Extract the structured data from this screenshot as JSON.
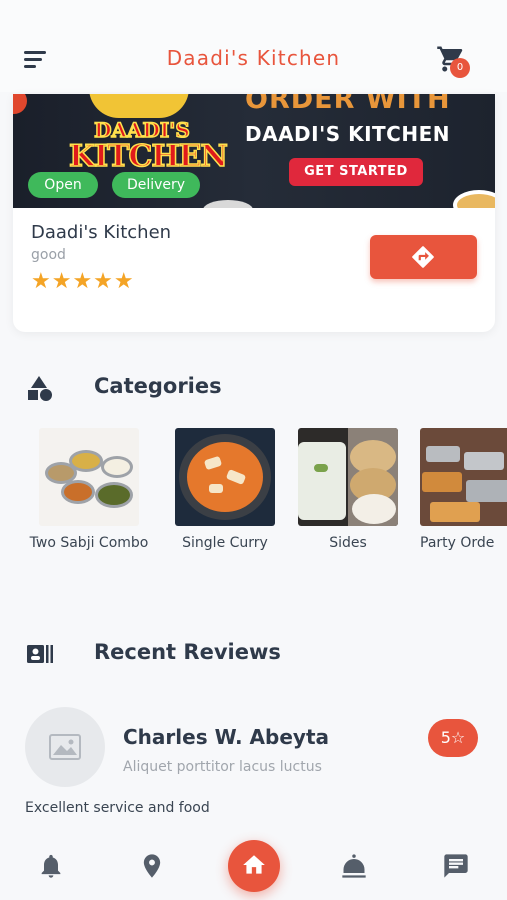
{
  "header": {
    "title": "Daadi's Kitchen",
    "cart_count": "0"
  },
  "restaurant": {
    "banner": {
      "logo_top": "DAADI'S",
      "logo_bottom": "KITCHEN",
      "promo_line1": "ORDER WITH",
      "promo_line2": "DAADI'S KITCHEN",
      "promo_cta": "GET STARTED"
    },
    "status_open": "Open",
    "status_delivery": "Delivery",
    "name": "Daadi's Kitchen",
    "tagline": "good",
    "rating": 5,
    "stars": "★★★★★"
  },
  "categories": {
    "title": "Categories",
    "items": [
      {
        "label": "Two Sabji Combo"
      },
      {
        "label": "Single Curry"
      },
      {
        "label": "Sides"
      },
      {
        "label": "Party Orde"
      }
    ]
  },
  "reviews": {
    "title": "Recent Reviews",
    "items": [
      {
        "name": "Charles W. Abeyta",
        "subtitle": "Aliquet porttitor lacus luctus",
        "score": "5☆",
        "text": "Excellent service and food"
      }
    ]
  },
  "bottom_nav": {
    "items": [
      "bell-icon",
      "location-pin-icon",
      "home-icon",
      "dish-icon",
      "chat-icon"
    ],
    "active": "home-icon"
  },
  "colors": {
    "accent": "#e8553d",
    "text": "#2f3a4a",
    "muted": "#9aa0a8",
    "star": "#f4a426",
    "open_green": "#3fb95b"
  }
}
